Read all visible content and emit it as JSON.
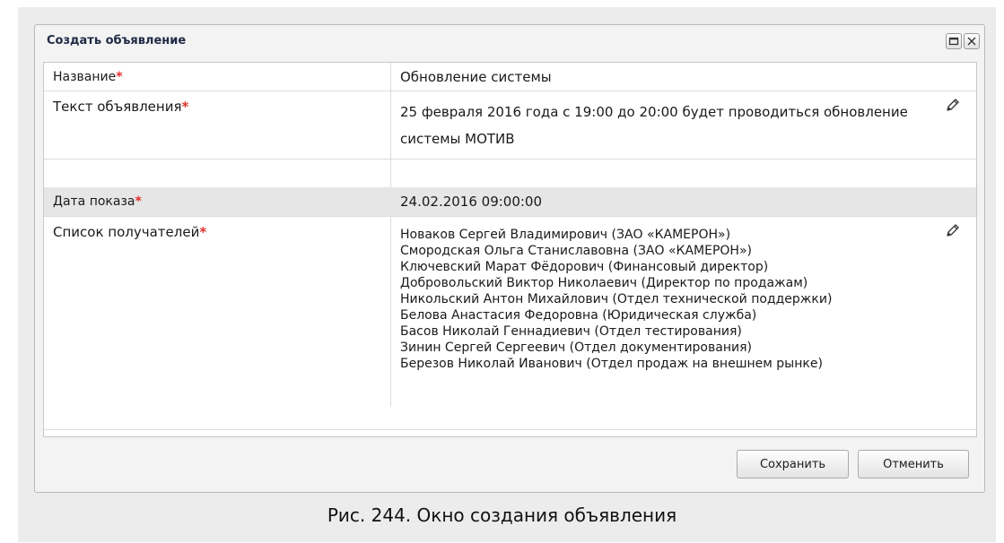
{
  "dialog": {
    "title": "Создать объявление"
  },
  "form": {
    "required_mark": "*",
    "name": {
      "label": "Название",
      "value": "Обновление системы"
    },
    "text": {
      "label": "Текст объявления",
      "value": "25 февраля 2016 года с 19:00 до 20:00 будет проводиться обновление системы МОТИВ"
    },
    "date": {
      "label": "Дата показа",
      "value": "24.02.2016 09:00:00"
    },
    "recipients": {
      "label": "Список получателей",
      "items": [
        "Новаков Сергей Владимирович (ЗАО «КАМЕРОН»)",
        "Смородская Ольга Станиславовна (ЗАО «КАМЕРОН»)",
        "Ключевский Марат Фёдорович (Финансовый директор)",
        "Добровольский Виктор Николаевич (Директор по продажам)",
        "Никольский Антон Михайлович (Отдел технической поддержки)",
        "Белова Анастасия Федоровна (Юридическая служба)",
        "Басов Николай Геннадиевич (Отдел тестирования)",
        "Зинин Сергей Сергеевич (Отдел документирования)",
        "Березов Николай Иванович (Отдел продаж на внешнем рынке)"
      ]
    }
  },
  "buttons": {
    "save": "Сохранить",
    "cancel": "Отменить"
  },
  "icons": {
    "edit": "pencil-icon",
    "maximize": "maximize-icon",
    "close": "close-icon"
  },
  "caption": "Рис. 244. Окно создания объявления"
}
